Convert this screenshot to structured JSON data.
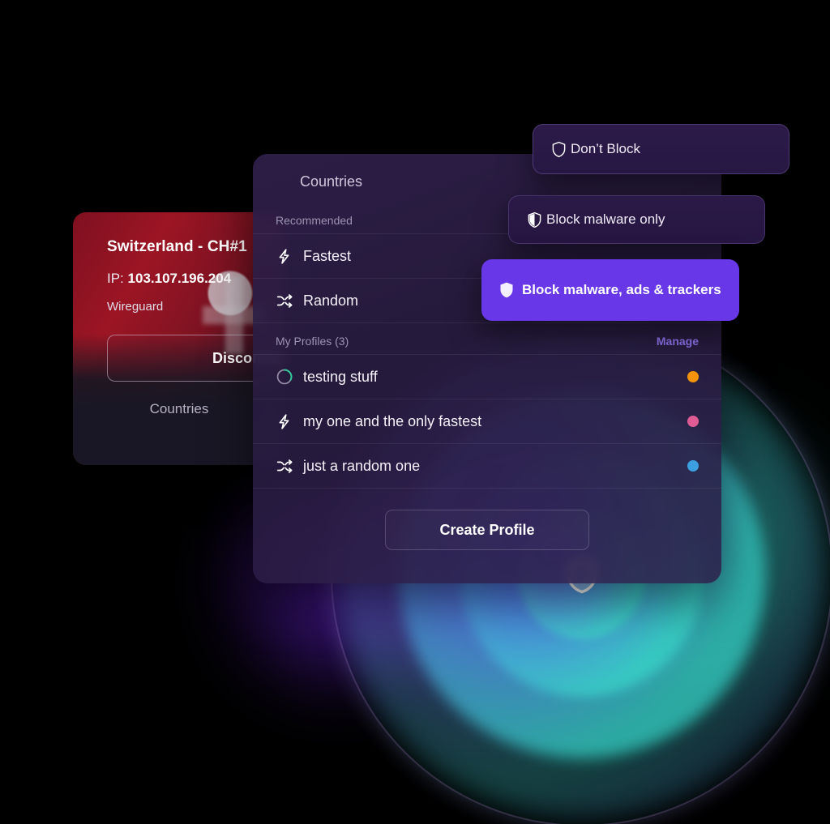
{
  "connection_card": {
    "title": "Switzerland - CH#1",
    "ip_label": "IP:",
    "ip_value": "103.107.196.204",
    "protocol": "Wireguard",
    "disconnect_label": "Disconnect",
    "countries_label": "Countries"
  },
  "main_card": {
    "header_title": "Countries",
    "recommended_label": "Recommended",
    "recommended_items": [
      {
        "label": "Fastest",
        "icon": "bolt-icon"
      },
      {
        "label": "Random",
        "icon": "shuffle-icon"
      }
    ],
    "profiles_label": "My Profiles (3)",
    "manage_label": "Manage",
    "profiles": [
      {
        "label": "testing stuff",
        "icon": "progress-ring-icon",
        "dot_color": "#F59308"
      },
      {
        "label": "my one and the only fastest",
        "icon": "bolt-icon",
        "dot_color": "#DE5B93"
      },
      {
        "label": "just a random one",
        "icon": "shuffle-icon",
        "dot_color": "#3C9FE0"
      }
    ],
    "create_profile_label": "Create Profile"
  },
  "block_options": [
    {
      "label": "Don’t Block",
      "icon": "shield-outline-icon",
      "selected": false
    },
    {
      "label": "Block malware only",
      "icon": "shield-half-icon",
      "selected": false
    },
    {
      "label": "Block malware, ads & trackers",
      "icon": "shield-filled-icon",
      "selected": true
    }
  ],
  "colors": {
    "accent_purple": "#6838E8",
    "manage_link": "#8D72EA",
    "ring_teal": "#34CEC4",
    "ring_blue": "#5C52F5",
    "status_green": "#2FCE9A"
  }
}
